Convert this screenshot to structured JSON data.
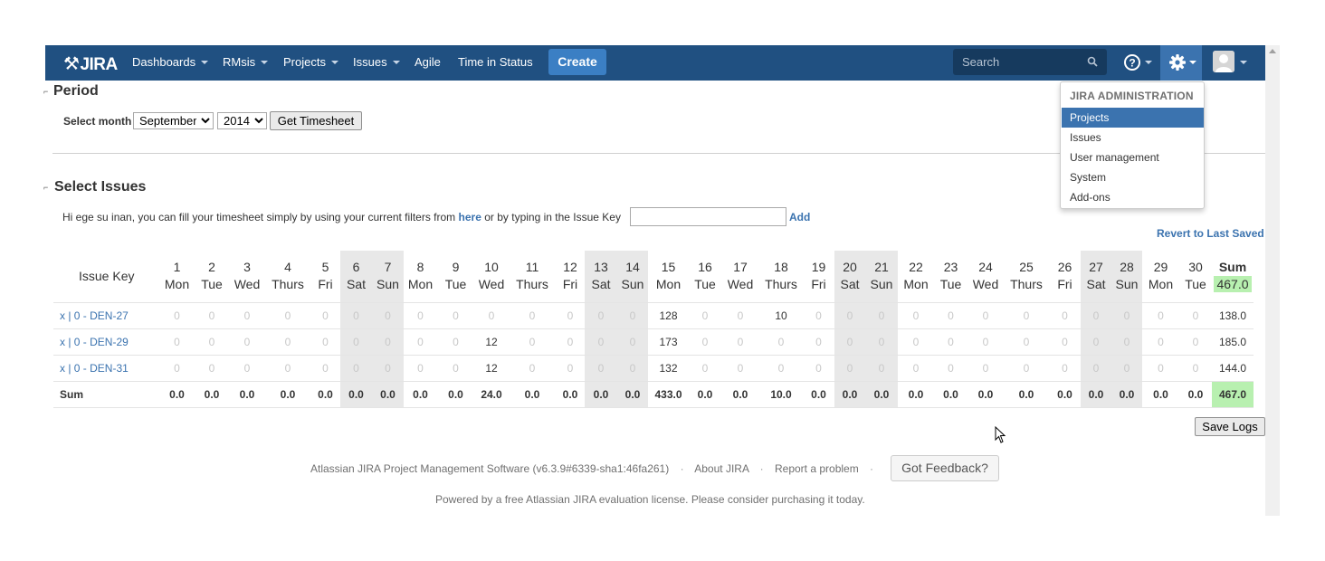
{
  "header": {
    "logo_text": "JIRA",
    "nav": [
      "Dashboards",
      "RMsis",
      "Projects",
      "Issues",
      "Agile",
      "Time in Status"
    ],
    "create_label": "Create",
    "search_placeholder": "Search"
  },
  "admin_menu": {
    "heading": "JIRA ADMINISTRATION",
    "items": [
      "Projects",
      "Issues",
      "User management",
      "System",
      "Add-ons"
    ],
    "active_item": "Projects"
  },
  "period": {
    "title": "Period",
    "select_month_label": "Select month",
    "month": "September",
    "year": "2014",
    "button": "Get Timesheet"
  },
  "select_issues": {
    "title": "Select Issues",
    "intro_before": "Hi ege su inan, you can fill your timesheet simply by using your current filters from",
    "here_link": "here",
    "intro_after": "or by typing in the Issue Key",
    "add_link": "Add",
    "revert_link": "Revert to Last Saved"
  },
  "timesheet": {
    "key_header": "Issue Key",
    "sum_header": "Sum",
    "total": "467.0",
    "days": [
      {
        "d": "1",
        "w": "Mon"
      },
      {
        "d": "2",
        "w": "Tue"
      },
      {
        "d": "3",
        "w": "Wed"
      },
      {
        "d": "4",
        "w": "Thurs"
      },
      {
        "d": "5",
        "w": "Fri"
      },
      {
        "d": "6",
        "w": "Sat"
      },
      {
        "d": "7",
        "w": "Sun"
      },
      {
        "d": "8",
        "w": "Mon"
      },
      {
        "d": "9",
        "w": "Tue"
      },
      {
        "d": "10",
        "w": "Wed"
      },
      {
        "d": "11",
        "w": "Thurs"
      },
      {
        "d": "12",
        "w": "Fri"
      },
      {
        "d": "13",
        "w": "Sat"
      },
      {
        "d": "14",
        "w": "Sun"
      },
      {
        "d": "15",
        "w": "Mon"
      },
      {
        "d": "16",
        "w": "Tue"
      },
      {
        "d": "17",
        "w": "Wed"
      },
      {
        "d": "18",
        "w": "Thurs"
      },
      {
        "d": "19",
        "w": "Fri"
      },
      {
        "d": "20",
        "w": "Sat"
      },
      {
        "d": "21",
        "w": "Sun"
      },
      {
        "d": "22",
        "w": "Mon"
      },
      {
        "d": "23",
        "w": "Tue"
      },
      {
        "d": "24",
        "w": "Wed"
      },
      {
        "d": "25",
        "w": "Thurs"
      },
      {
        "d": "26",
        "w": "Fri"
      },
      {
        "d": "27",
        "w": "Sat"
      },
      {
        "d": "28",
        "w": "Sun"
      },
      {
        "d": "29",
        "w": "Mon"
      },
      {
        "d": "30",
        "w": "Tue"
      }
    ],
    "rows": [
      {
        "key": "x | 0 - DEN-27",
        "values": [
          "0",
          "0",
          "0",
          "0",
          "0",
          "0",
          "0",
          "0",
          "0",
          "0",
          "0",
          "0",
          "0",
          "0",
          "128",
          "0",
          "0",
          "10",
          "0",
          "0",
          "0",
          "0",
          "0",
          "0",
          "0",
          "0",
          "0",
          "0",
          "0",
          "0"
        ],
        "sum": "138.0"
      },
      {
        "key": "x | 0 - DEN-29",
        "values": [
          "0",
          "0",
          "0",
          "0",
          "0",
          "0",
          "0",
          "0",
          "0",
          "12",
          "0",
          "0",
          "0",
          "0",
          "173",
          "0",
          "0",
          "0",
          "0",
          "0",
          "0",
          "0",
          "0",
          "0",
          "0",
          "0",
          "0",
          "0",
          "0",
          "0"
        ],
        "sum": "185.0"
      },
      {
        "key": "x | 0 - DEN-31",
        "values": [
          "0",
          "0",
          "0",
          "0",
          "0",
          "0",
          "0",
          "0",
          "0",
          "12",
          "0",
          "0",
          "0",
          "0",
          "132",
          "0",
          "0",
          "0",
          "0",
          "0",
          "0",
          "0",
          "0",
          "0",
          "0",
          "0",
          "0",
          "0",
          "0",
          "0"
        ],
        "sum": "144.0"
      }
    ],
    "sum_row": {
      "label": "Sum",
      "values": [
        "0.0",
        "0.0",
        "0.0",
        "0.0",
        "0.0",
        "0.0",
        "0.0",
        "0.0",
        "0.0",
        "24.0",
        "0.0",
        "0.0",
        "0.0",
        "0.0",
        "433.0",
        "0.0",
        "0.0",
        "10.0",
        "0.0",
        "0.0",
        "0.0",
        "0.0",
        "0.0",
        "0.0",
        "0.0",
        "0.0",
        "0.0",
        "0.0",
        "0.0",
        "0.0"
      ],
      "total": "467.0"
    },
    "save_button": "Save Logs"
  },
  "footer": {
    "software": "Atlassian JIRA Project Management Software (v6.3.9#6339-sha1:46fa261)",
    "about": "About JIRA",
    "report": "Report a problem",
    "feedback": "Got Feedback?",
    "powered": "Powered by a free Atlassian JIRA evaluation license. Please consider purchasing it today."
  },
  "colors": {
    "header_bg": "#205081",
    "create_bg": "#3b7fc4",
    "link": "#3b73af",
    "total_highlight": "#b8f0b0",
    "weekend_bg": "#e8e8e8"
  }
}
